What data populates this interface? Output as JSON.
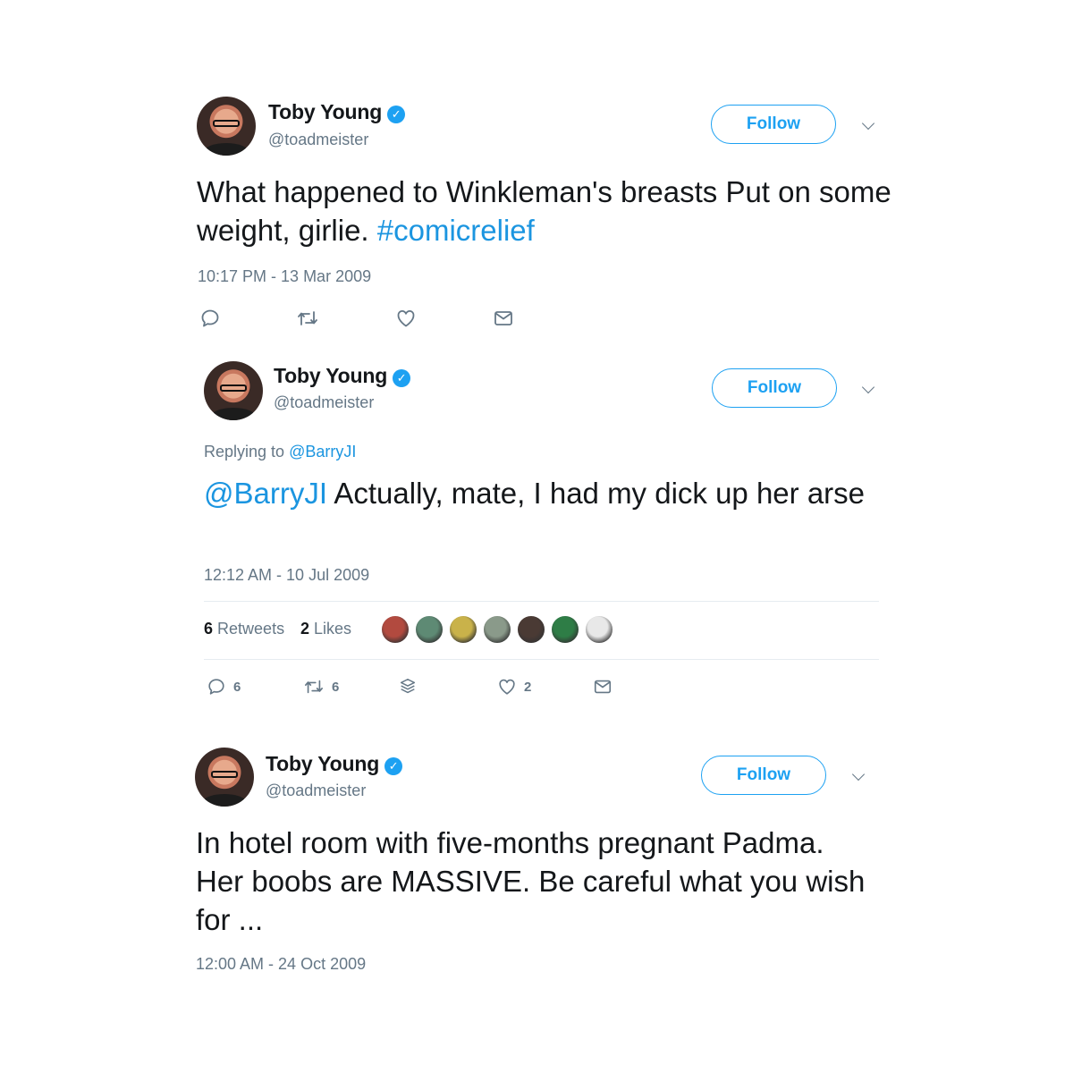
{
  "tweets": [
    {
      "author_name": "Toby Young",
      "handle": "@toadmeister",
      "follow_label": "Follow",
      "text_plain": "What happened to Winkleman's breasts Put on some weight, girlie. ",
      "hashtag": "#comicrelief",
      "timestamp": "10:17 PM - 13 Mar 2009"
    },
    {
      "author_name": "Toby Young",
      "handle": "@toadmeister",
      "follow_label": "Follow",
      "reply_prefix": "Replying to ",
      "reply_to": "@BarryJI",
      "mention": "@BarryJI",
      "text_plain": " Actually, mate, I had my dick up her arse",
      "timestamp": "12:12 AM - 10 Jul 2009",
      "retweets_count": "6",
      "retweets_label": "Retweets",
      "likes_count": "2",
      "likes_label": "Likes",
      "liker_avatar_colors": [
        "#b24a3f",
        "#5e8a74",
        "#c9b24a",
        "#8a9a8a",
        "#4a3a34",
        "#2e7d46",
        "#e8e8e8"
      ],
      "actions": {
        "reply_count": "6",
        "retweet_count": "6",
        "like_count": "2"
      }
    },
    {
      "author_name": "Toby Young",
      "handle": "@toadmeister",
      "follow_label": "Follow",
      "text_plain": "In hotel room with five-months pregnant Padma. Her boobs are MASSIVE. Be careful what you wish for ...",
      "timestamp": "12:00 AM - 24 Oct 2009"
    }
  ],
  "colors": {
    "accent": "#1da1f2",
    "link": "#1b95e0",
    "secondary_text": "#657786",
    "divider": "#e6ecf0"
  },
  "icons": [
    "reply-icon",
    "retweet-icon",
    "like-icon",
    "message-icon",
    "verified-icon",
    "chevron-down-icon",
    "moments-icon"
  ]
}
